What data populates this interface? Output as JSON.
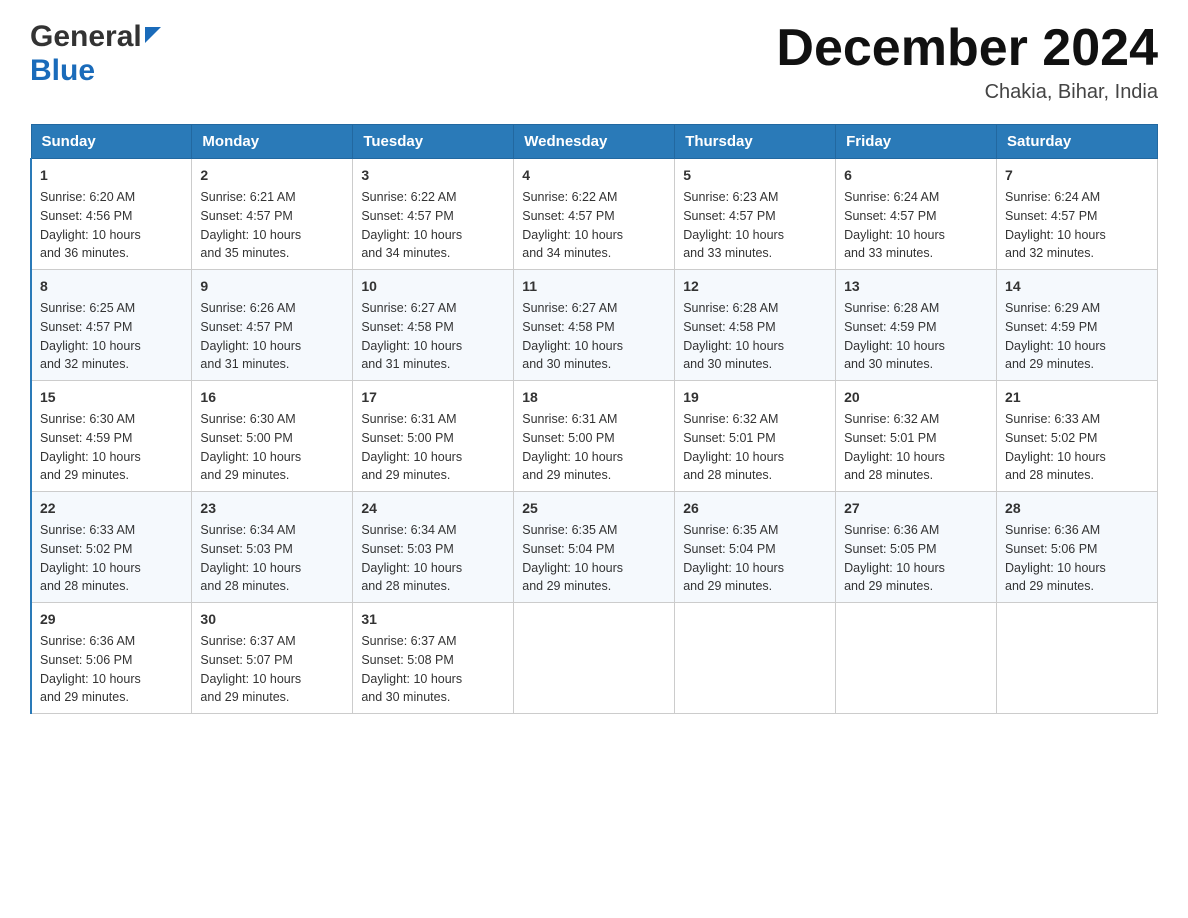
{
  "header": {
    "logo_general": "General",
    "logo_blue": "Blue",
    "month_title": "December 2024",
    "location": "Chakia, Bihar, India"
  },
  "weekdays": [
    "Sunday",
    "Monday",
    "Tuesday",
    "Wednesday",
    "Thursday",
    "Friday",
    "Saturday"
  ],
  "weeks": [
    [
      {
        "day": "1",
        "sunrise": "6:20 AM",
        "sunset": "4:56 PM",
        "daylight": "10 hours and 36 minutes."
      },
      {
        "day": "2",
        "sunrise": "6:21 AM",
        "sunset": "4:57 PM",
        "daylight": "10 hours and 35 minutes."
      },
      {
        "day": "3",
        "sunrise": "6:22 AM",
        "sunset": "4:57 PM",
        "daylight": "10 hours and 34 minutes."
      },
      {
        "day": "4",
        "sunrise": "6:22 AM",
        "sunset": "4:57 PM",
        "daylight": "10 hours and 34 minutes."
      },
      {
        "day": "5",
        "sunrise": "6:23 AM",
        "sunset": "4:57 PM",
        "daylight": "10 hours and 33 minutes."
      },
      {
        "day": "6",
        "sunrise": "6:24 AM",
        "sunset": "4:57 PM",
        "daylight": "10 hours and 33 minutes."
      },
      {
        "day": "7",
        "sunrise": "6:24 AM",
        "sunset": "4:57 PM",
        "daylight": "10 hours and 32 minutes."
      }
    ],
    [
      {
        "day": "8",
        "sunrise": "6:25 AM",
        "sunset": "4:57 PM",
        "daylight": "10 hours and 32 minutes."
      },
      {
        "day": "9",
        "sunrise": "6:26 AM",
        "sunset": "4:57 PM",
        "daylight": "10 hours and 31 minutes."
      },
      {
        "day": "10",
        "sunrise": "6:27 AM",
        "sunset": "4:58 PM",
        "daylight": "10 hours and 31 minutes."
      },
      {
        "day": "11",
        "sunrise": "6:27 AM",
        "sunset": "4:58 PM",
        "daylight": "10 hours and 30 minutes."
      },
      {
        "day": "12",
        "sunrise": "6:28 AM",
        "sunset": "4:58 PM",
        "daylight": "10 hours and 30 minutes."
      },
      {
        "day": "13",
        "sunrise": "6:28 AM",
        "sunset": "4:59 PM",
        "daylight": "10 hours and 30 minutes."
      },
      {
        "day": "14",
        "sunrise": "6:29 AM",
        "sunset": "4:59 PM",
        "daylight": "10 hours and 29 minutes."
      }
    ],
    [
      {
        "day": "15",
        "sunrise": "6:30 AM",
        "sunset": "4:59 PM",
        "daylight": "10 hours and 29 minutes."
      },
      {
        "day": "16",
        "sunrise": "6:30 AM",
        "sunset": "5:00 PM",
        "daylight": "10 hours and 29 minutes."
      },
      {
        "day": "17",
        "sunrise": "6:31 AM",
        "sunset": "5:00 PM",
        "daylight": "10 hours and 29 minutes."
      },
      {
        "day": "18",
        "sunrise": "6:31 AM",
        "sunset": "5:00 PM",
        "daylight": "10 hours and 29 minutes."
      },
      {
        "day": "19",
        "sunrise": "6:32 AM",
        "sunset": "5:01 PM",
        "daylight": "10 hours and 28 minutes."
      },
      {
        "day": "20",
        "sunrise": "6:32 AM",
        "sunset": "5:01 PM",
        "daylight": "10 hours and 28 minutes."
      },
      {
        "day": "21",
        "sunrise": "6:33 AM",
        "sunset": "5:02 PM",
        "daylight": "10 hours and 28 minutes."
      }
    ],
    [
      {
        "day": "22",
        "sunrise": "6:33 AM",
        "sunset": "5:02 PM",
        "daylight": "10 hours and 28 minutes."
      },
      {
        "day": "23",
        "sunrise": "6:34 AM",
        "sunset": "5:03 PM",
        "daylight": "10 hours and 28 minutes."
      },
      {
        "day": "24",
        "sunrise": "6:34 AM",
        "sunset": "5:03 PM",
        "daylight": "10 hours and 28 minutes."
      },
      {
        "day": "25",
        "sunrise": "6:35 AM",
        "sunset": "5:04 PM",
        "daylight": "10 hours and 29 minutes."
      },
      {
        "day": "26",
        "sunrise": "6:35 AM",
        "sunset": "5:04 PM",
        "daylight": "10 hours and 29 minutes."
      },
      {
        "day": "27",
        "sunrise": "6:36 AM",
        "sunset": "5:05 PM",
        "daylight": "10 hours and 29 minutes."
      },
      {
        "day": "28",
        "sunrise": "6:36 AM",
        "sunset": "5:06 PM",
        "daylight": "10 hours and 29 minutes."
      }
    ],
    [
      {
        "day": "29",
        "sunrise": "6:36 AM",
        "sunset": "5:06 PM",
        "daylight": "10 hours and 29 minutes."
      },
      {
        "day": "30",
        "sunrise": "6:37 AM",
        "sunset": "5:07 PM",
        "daylight": "10 hours and 29 minutes."
      },
      {
        "day": "31",
        "sunrise": "6:37 AM",
        "sunset": "5:08 PM",
        "daylight": "10 hours and 30 minutes."
      },
      null,
      null,
      null,
      null
    ]
  ],
  "labels": {
    "sunrise": "Sunrise:",
    "sunset": "Sunset:",
    "daylight": "Daylight:"
  }
}
